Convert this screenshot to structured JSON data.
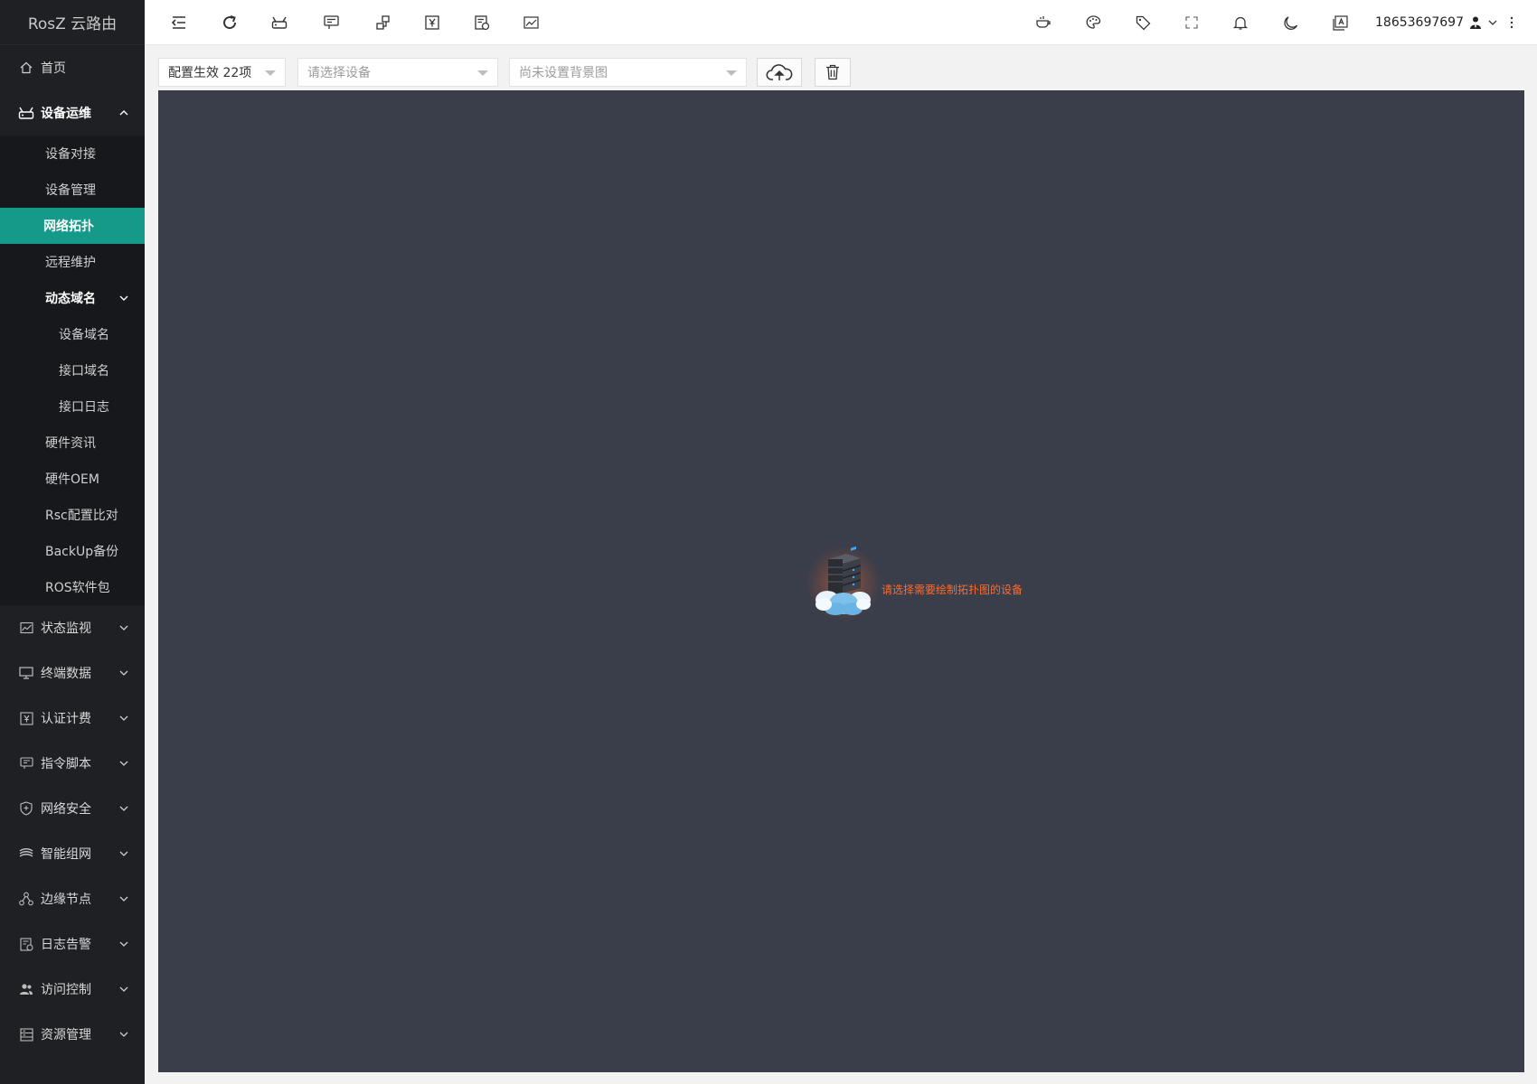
{
  "brand": {
    "title": "RosZ 云路由"
  },
  "sidebar": {
    "home": {
      "label": "首页",
      "icon": "home-icon"
    },
    "device_ops": {
      "label": "设备运维",
      "icon": "router-icon",
      "items": [
        {
          "label": "设备对接"
        },
        {
          "label": "设备管理"
        },
        {
          "label": "网络拓扑"
        },
        {
          "label": "远程维护"
        }
      ],
      "ddns": {
        "label": "动态域名",
        "items": [
          {
            "label": "设备域名"
          },
          {
            "label": "接口域名"
          },
          {
            "label": "接口日志"
          }
        ]
      },
      "more_items": [
        {
          "label": "硬件资讯"
        },
        {
          "label": "硬件OEM"
        },
        {
          "label": "Rsc配置比对"
        },
        {
          "label": "BackUp备份"
        },
        {
          "label": "ROS软件包"
        }
      ]
    },
    "groups": [
      {
        "label": "状态监视",
        "icon": "chart-icon"
      },
      {
        "label": "终端数据",
        "icon": "monitor-icon"
      },
      {
        "label": "认证计费",
        "icon": "yen-icon"
      },
      {
        "label": "指令脚本",
        "icon": "script-icon"
      },
      {
        "label": "网络安全",
        "icon": "shield-icon"
      },
      {
        "label": "智能组网",
        "icon": "layers-icon"
      },
      {
        "label": "边缘节点",
        "icon": "nodes-icon"
      },
      {
        "label": "日志告警",
        "icon": "log-icon"
      },
      {
        "label": "访问控制",
        "icon": "users-icon"
      },
      {
        "label": "资源管理",
        "icon": "database-icon"
      }
    ]
  },
  "header": {
    "user": "18653697697"
  },
  "toolbar": {
    "config_select": "配置生效 22项",
    "device_select_placeholder": "请选择设备",
    "background_select_placeholder": "尚未设置背景图"
  },
  "canvas": {
    "empty_message": "请选择需要绘制拓扑图的设备"
  },
  "colors": {
    "sidebar_bg": "#1f2024",
    "active": "#159a8a",
    "canvas_bg": "#3a3d4a",
    "message": "#ff6a2a"
  }
}
